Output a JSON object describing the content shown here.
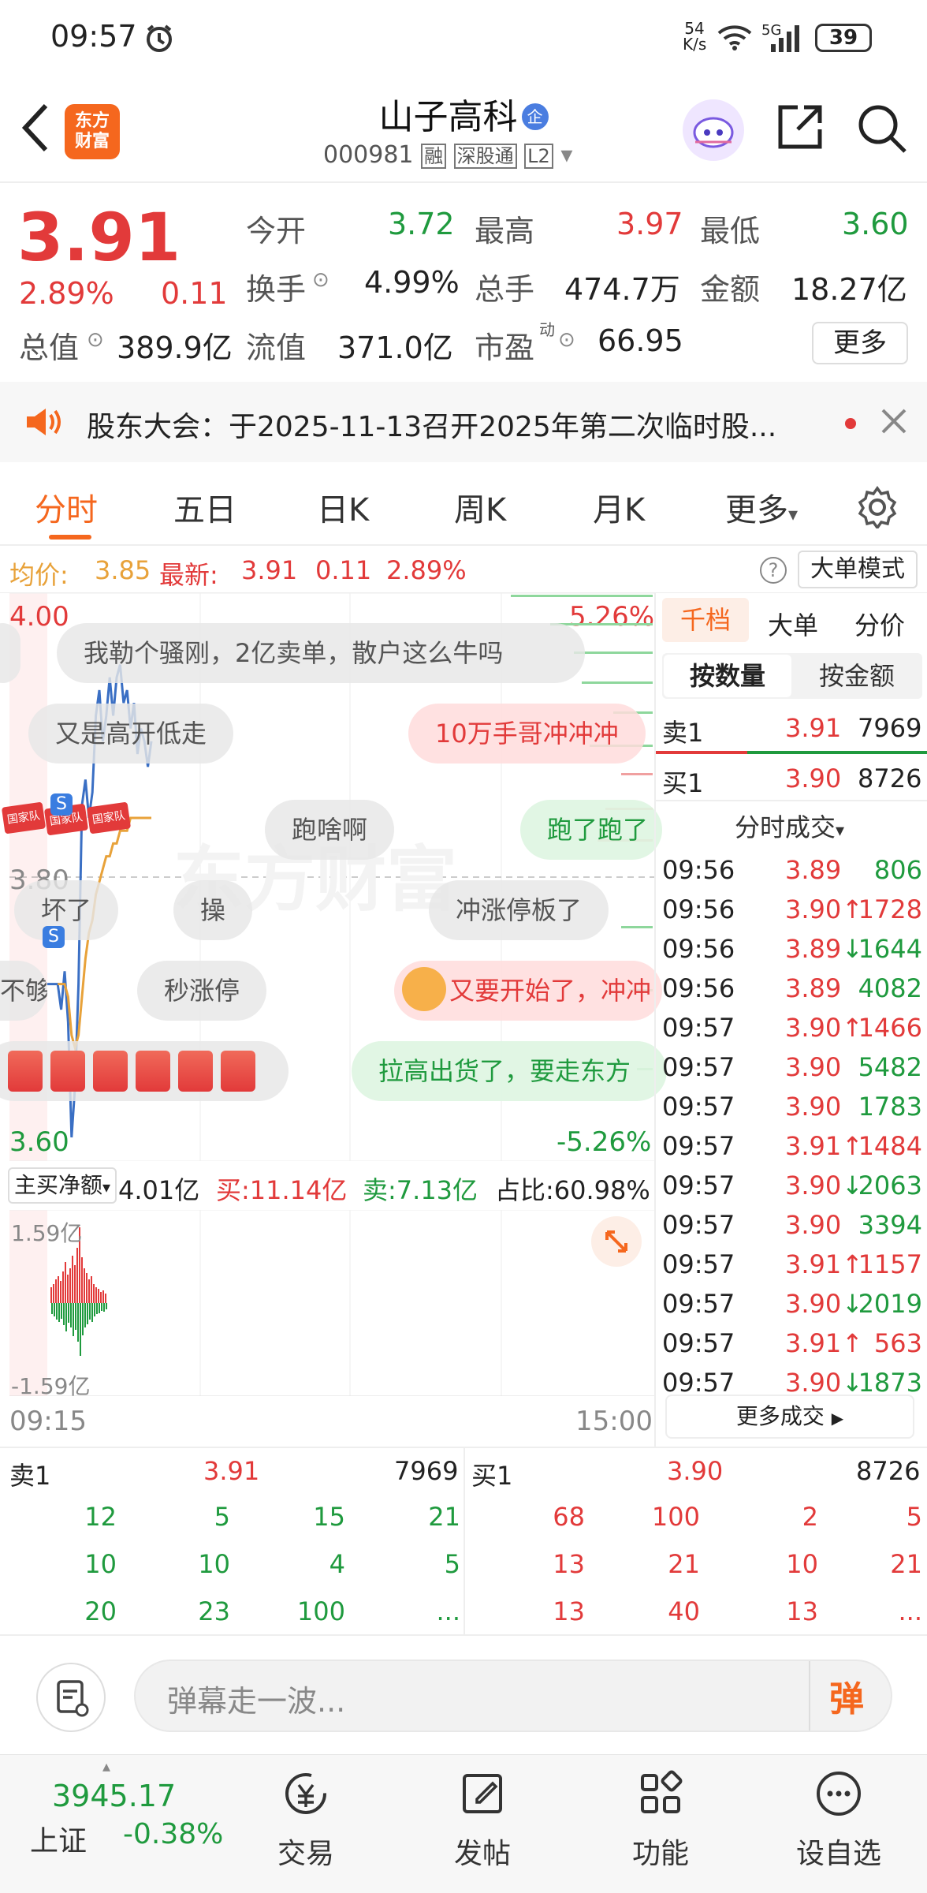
{
  "status": {
    "time": "09:57",
    "speed_value": "54",
    "speed_unit": "K/s",
    "network": "5G",
    "battery": "39"
  },
  "header": {
    "logo_line1": "东方",
    "logo_line2": "财富",
    "stock_name": "山子高科",
    "enterprise_badge": "企",
    "stock_code": "000981",
    "tag_margin": "融",
    "tag_connect": "深股通",
    "tag_level": "L2"
  },
  "quote": {
    "price": "3.91",
    "change_pct": "2.89%",
    "change_amt": "0.11",
    "total_value_label": "总值",
    "total_value": "389.9亿",
    "open_label": "今开",
    "open": "3.72",
    "high_label": "最高",
    "high": "3.97",
    "low_label": "最低",
    "low": "3.60",
    "turnover_label": "换手",
    "turnover": "4.99%",
    "volume_label": "总手",
    "volume": "474.7万",
    "amount_label": "金额",
    "amount": "18.27亿",
    "float_label": "流值",
    "float_value": "371.0亿",
    "pe_label": "市盈",
    "pe_sup": "动",
    "pe": "66.95",
    "more_label": "更多"
  },
  "notice": {
    "text": "股东大会：于2025-11-13召开2025年第二次临时股..."
  },
  "tabs": {
    "items": [
      "分时",
      "五日",
      "日K",
      "周K",
      "月K"
    ],
    "more": "更多",
    "active": "分时"
  },
  "infoline": {
    "avg_label": "均价:",
    "avg_value": "3.85",
    "latest_label": "最新:",
    "latest_value": "3.91",
    "latest_change": "0.11",
    "latest_pct": "2.89%",
    "mode_button": "大单模式"
  },
  "chart": {
    "y_top": "4.00",
    "y_mid": "3.80",
    "y_bottom": "3.60",
    "pct_top": "5.26%",
    "pct_bottom": "-5.26%",
    "watermark": "东方财富",
    "danmu": [
      "我勒个骚刚，2亿卖单，散户这么牛吗",
      "又是高开低走",
      "10万手哥冲冲冲",
      "跑啥啊",
      "跑了跑了",
      "坏了",
      "操",
      "冲涨停板了",
      "不够",
      "秒涨停",
      "又要开始了，冲冲",
      "拉高出货了，要走东方"
    ],
    "flag_label": "国家队",
    "s_marker": "S",
    "flow_dropdown": "主买净额",
    "flow_net": "4.01亿",
    "flow_buy": "买:11.14亿",
    "flow_sell": "卖:7.13亿",
    "flow_ratio": "占比:60.98%",
    "sub_top": "1.59亿",
    "sub_bottom": "-1.59亿",
    "time_start": "09:15",
    "time_end": "15:00"
  },
  "chart_data": {
    "type": "line",
    "title": "",
    "x": [
      "09:15",
      "09:20",
      "09:25",
      "09:30",
      "09:31",
      "09:32",
      "09:33",
      "09:34",
      "09:35",
      "09:36",
      "09:37",
      "09:38",
      "09:39",
      "09:40",
      "09:41",
      "09:42",
      "09:43",
      "09:44",
      "09:45",
      "09:46",
      "09:47",
      "09:48",
      "09:49",
      "09:50",
      "09:51",
      "09:52",
      "09:53",
      "09:54",
      "09:55",
      "09:56",
      "09:57"
    ],
    "series": [
      {
        "name": "最新",
        "values": [
          3.72,
          3.72,
          3.72,
          3.72,
          3.7,
          3.73,
          3.69,
          3.6,
          3.64,
          3.72,
          3.86,
          3.88,
          3.85,
          3.87,
          3.93,
          3.95,
          3.91,
          3.93,
          3.96,
          3.93,
          3.96,
          3.97,
          3.94,
          3.95,
          3.92,
          3.94,
          3.9,
          3.92,
          3.91,
          3.89,
          3.91
        ]
      },
      {
        "name": "均价",
        "values": [
          null,
          null,
          null,
          3.72,
          3.72,
          3.72,
          3.71,
          3.68,
          3.67,
          3.68,
          3.71,
          3.74,
          3.76,
          3.77,
          3.79,
          3.8,
          3.81,
          3.82,
          3.82,
          3.83,
          3.83,
          3.84,
          3.84,
          3.84,
          3.85,
          3.85,
          3.85,
          3.85,
          3.85,
          3.85,
          3.85
        ]
      }
    ],
    "ylim": [
      3.6,
      4.0
    ],
    "pct_range": [
      "-5.26%",
      "5.26%"
    ],
    "xlabel": "",
    "ylabel": ""
  },
  "right_panel": {
    "tabs": [
      "千档",
      "大单",
      "分价"
    ],
    "sub_tabs": [
      "按数量",
      "按金额"
    ],
    "sell1": {
      "label": "卖1",
      "price": "3.91",
      "qty": "7969"
    },
    "buy1": {
      "label": "买1",
      "price": "3.90",
      "qty": "8726"
    },
    "ticks_title": "分时成交",
    "ticks": [
      {
        "time": "09:56",
        "price": "3.89",
        "arrow": "",
        "qty": "806",
        "color": "green"
      },
      {
        "time": "09:56",
        "price": "3.90",
        "arrow": "↑",
        "qty": "1728",
        "color": "red"
      },
      {
        "time": "09:56",
        "price": "3.89",
        "arrow": "↓",
        "qty": "1644",
        "color": "green"
      },
      {
        "time": "09:56",
        "price": "3.89",
        "arrow": "",
        "qty": "4082",
        "color": "green"
      },
      {
        "time": "09:57",
        "price": "3.90",
        "arrow": "↑",
        "qty": "1466",
        "color": "red"
      },
      {
        "time": "09:57",
        "price": "3.90",
        "arrow": "",
        "qty": "5482",
        "color": "green"
      },
      {
        "time": "09:57",
        "price": "3.90",
        "arrow": "",
        "qty": "1783",
        "color": "green"
      },
      {
        "time": "09:57",
        "price": "3.91",
        "arrow": "↑",
        "qty": "1484",
        "color": "red"
      },
      {
        "time": "09:57",
        "price": "3.90",
        "arrow": "↓",
        "qty": "2063",
        "color": "green"
      },
      {
        "time": "09:57",
        "price": "3.90",
        "arrow": "",
        "qty": "3394",
        "color": "green"
      },
      {
        "time": "09:57",
        "price": "3.91",
        "arrow": "↑",
        "qty": "1157",
        "color": "red"
      },
      {
        "time": "09:57",
        "price": "3.90",
        "arrow": "↓",
        "qty": "2019",
        "color": "green"
      },
      {
        "time": "09:57",
        "price": "3.91",
        "arrow": "↑",
        "qty": "563",
        "color": "red"
      },
      {
        "time": "09:57",
        "price": "3.90",
        "arrow": "↓",
        "qty": "1873",
        "color": "green"
      }
    ],
    "more_ticks": "更多成交"
  },
  "depth": {
    "sell": {
      "label": "卖1",
      "price": "3.91",
      "qty": "7969",
      "rows": [
        [
          "12",
          "5",
          "15",
          "21"
        ],
        [
          "10",
          "10",
          "4",
          "5"
        ],
        [
          "20",
          "23",
          "100",
          "..."
        ]
      ]
    },
    "buy": {
      "label": "买1",
      "price": "3.90",
      "qty": "8726",
      "rows": [
        [
          "68",
          "100",
          "2",
          "5"
        ],
        [
          "13",
          "21",
          "10",
          "21"
        ],
        [
          "13",
          "40",
          "13",
          "..."
        ]
      ]
    }
  },
  "danmu_input": {
    "placeholder": "弹幕走一波...",
    "button": "弹"
  },
  "bottom_nav": {
    "index_value": "3945.17",
    "index_name": "上证",
    "index_change": "-0.38%",
    "items": [
      "交易",
      "发帖",
      "功能",
      "设自选"
    ]
  },
  "colors": {
    "red": "#e23a3a",
    "green": "#1f9a3e",
    "accent": "#f5671e",
    "avg_line": "#e8a23a",
    "price_line": "#3a6fc4"
  }
}
